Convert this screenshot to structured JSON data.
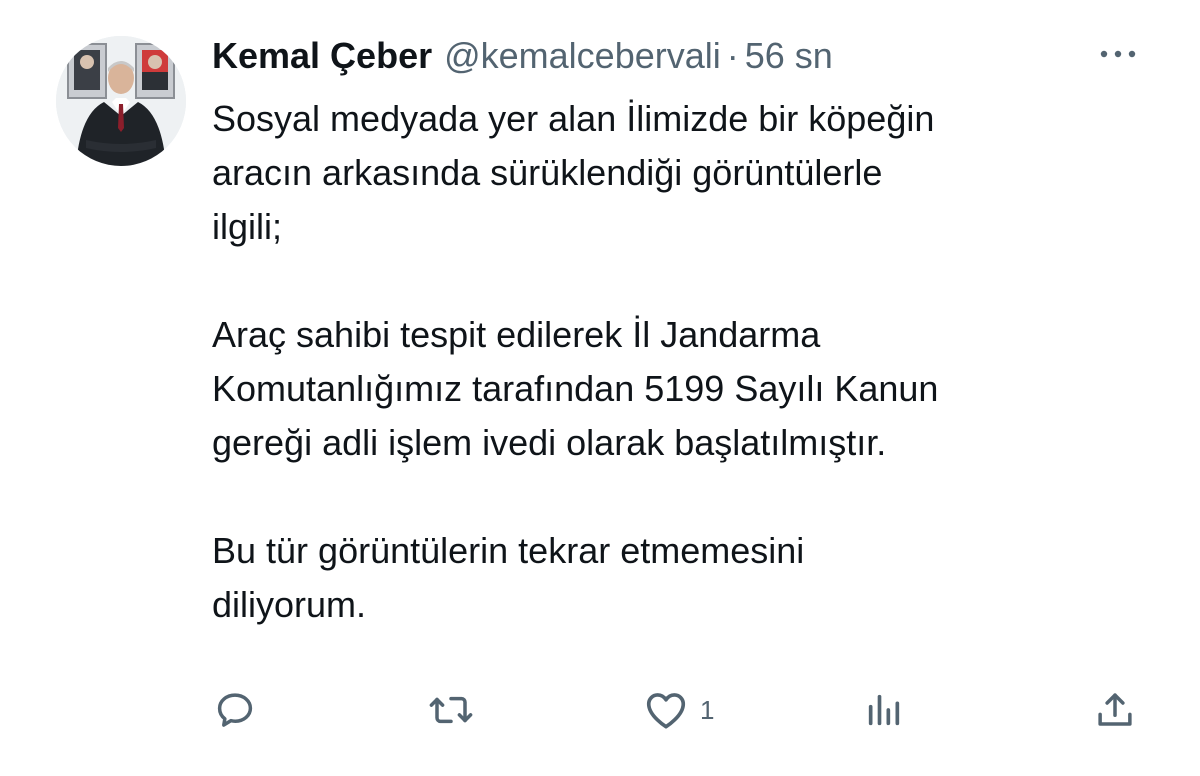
{
  "tweet": {
    "author_name": "Kemal Çeber",
    "handle": "@kemalcebervali",
    "separator": "·",
    "time": "56 sn",
    "paragraphs": [
      [
        "Sosyal medyada yer alan İlimizde bir köpeğin",
        "aracın arkasında sürüklendiği görüntülerle",
        "ilgili;"
      ],
      [
        "Araç sahibi tespit edilerek İl Jandarma",
        "Komutanlığımız tarafından 5199 Sayılı Kanun",
        "gereği adli işlem ivedi olarak başlatılmıştır."
      ],
      [
        "Bu tür görüntülerin tekrar etmemesini",
        "diliyorum."
      ]
    ]
  },
  "actions": {
    "reply_icon": "reply-icon",
    "retweet_icon": "retweet-icon",
    "like_icon": "heart-icon",
    "like_count": "1",
    "views_icon": "analytics-icon",
    "share_icon": "share-icon"
  },
  "colors": {
    "text": "#0f1419",
    "secondary": "#536471",
    "background": "#ffffff"
  }
}
